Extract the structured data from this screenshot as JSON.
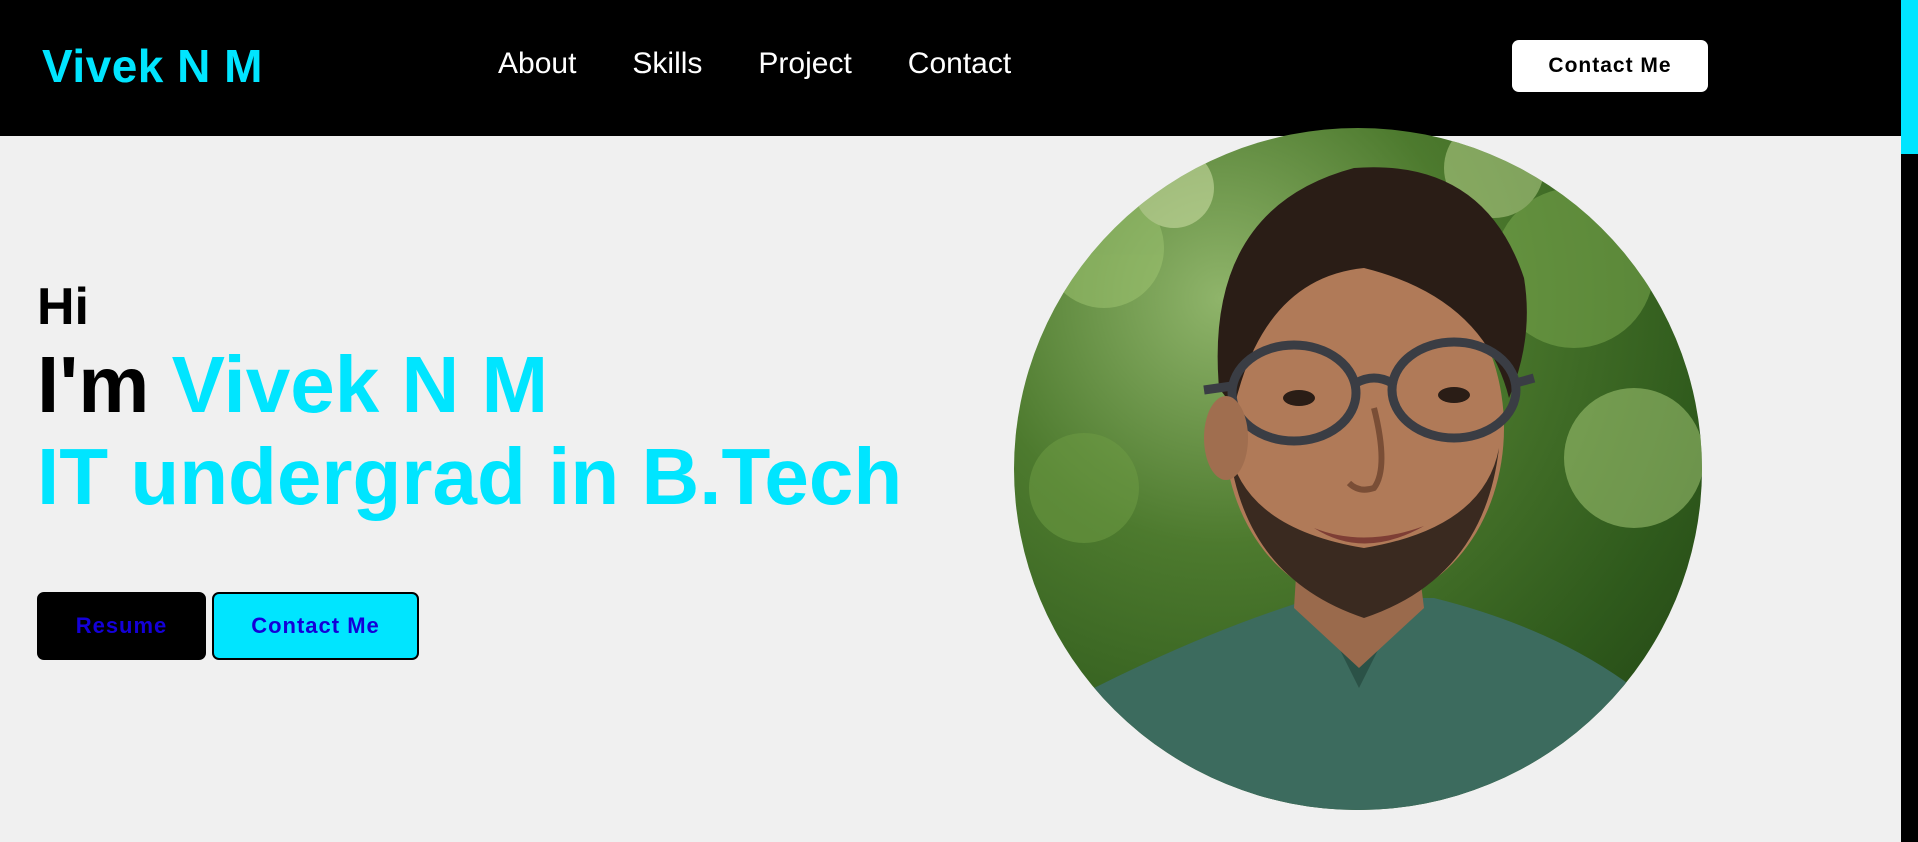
{
  "nav": {
    "brand": "Vivek N M",
    "links": [
      "About",
      "Skills",
      "Project",
      "Contact"
    ],
    "cta_label": "Contact Me"
  },
  "hero": {
    "greeting": "Hi",
    "name_prefix": "I'm",
    "name": "Vivek N M",
    "role": "IT undergrad in B.Tech",
    "resume_label": "Resume",
    "contact_label": "Contact Me"
  },
  "colors": {
    "accent": "#00e5ff",
    "nav_background": "#000000",
    "page_background": "#f0f0f0",
    "button_text": "#1400d8"
  },
  "icons": {
    "portrait": "profile-photo"
  }
}
